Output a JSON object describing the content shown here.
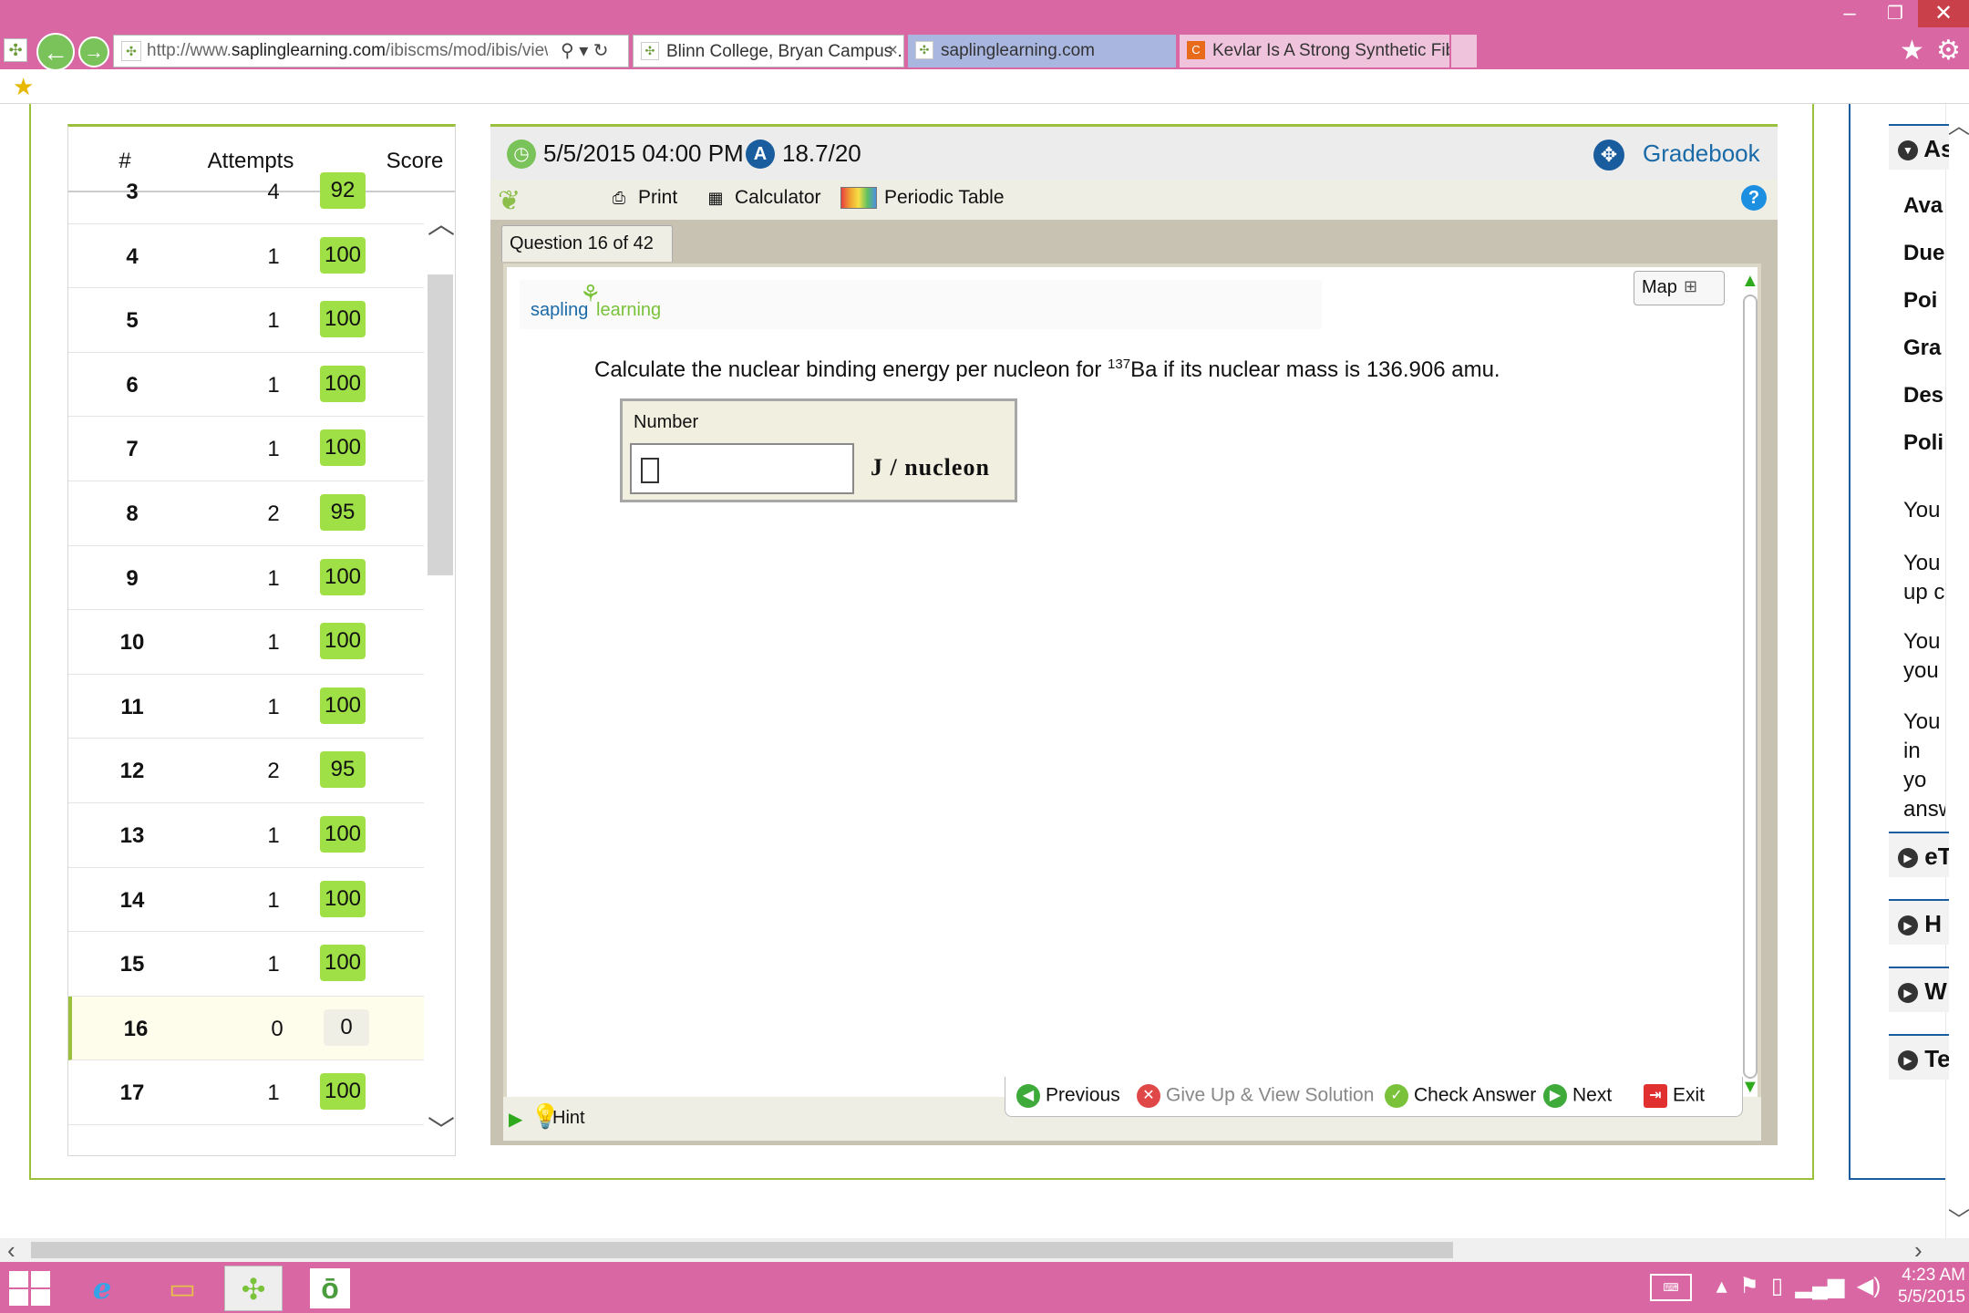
{
  "browser": {
    "window_controls": {
      "minimize": "–",
      "maximize": "❐",
      "close": "✕"
    },
    "back": "←",
    "forward": "→",
    "address_prefix": "http://www.",
    "address_domain": "saplinglearning.com",
    "address_path": "/ibiscms/mod/ibis/view.p",
    "address_tools": "⚲ ▾ ↻",
    "tabs": [
      {
        "label": "Blinn College, Bryan Campus ...",
        "close": "×"
      },
      {
        "label": "saplinglearning.com"
      },
      {
        "label": "Kevlar Is A Strong Synthetic Fib..."
      }
    ],
    "icons": {
      "favorites": "★",
      "tools": "⚙",
      "fav_bar_star": "★"
    }
  },
  "score_table": {
    "headers": {
      "num": "#",
      "attempts": "Attempts",
      "score": "Score"
    },
    "rows": [
      {
        "num": "3",
        "attempts": "4",
        "score": "92"
      },
      {
        "num": "4",
        "attempts": "1",
        "score": "100"
      },
      {
        "num": "5",
        "attempts": "1",
        "score": "100"
      },
      {
        "num": "6",
        "attempts": "1",
        "score": "100"
      },
      {
        "num": "7",
        "attempts": "1",
        "score": "100"
      },
      {
        "num": "8",
        "attempts": "2",
        "score": "95"
      },
      {
        "num": "9",
        "attempts": "1",
        "score": "100"
      },
      {
        "num": "10",
        "attempts": "1",
        "score": "100"
      },
      {
        "num": "11",
        "attempts": "1",
        "score": "100"
      },
      {
        "num": "12",
        "attempts": "2",
        "score": "95"
      },
      {
        "num": "13",
        "attempts": "1",
        "score": "100"
      },
      {
        "num": "14",
        "attempts": "1",
        "score": "100"
      },
      {
        "num": "15",
        "attempts": "1",
        "score": "100"
      },
      {
        "num": "16",
        "attempts": "0",
        "score": "0",
        "current": true
      },
      {
        "num": "17",
        "attempts": "1",
        "score": "100"
      }
    ]
  },
  "question": {
    "due_date": "5/5/2015 04:00 PM",
    "score": "18.7/20",
    "gradebook": "Gradebook",
    "tools": {
      "print": "Print",
      "calculator": "Calculator",
      "periodic_table": "Periodic Table"
    },
    "tab_label": "Question 16 of 42",
    "logo_part1": "sapling",
    "logo_part2": "learning",
    "map_label": "Map",
    "prompt_before": "Calculate the nuclear binding energy per nucleon for ",
    "isotope_mass_number": "137",
    "prompt_after": "Ba if its nuclear mass is 136.906 amu.",
    "answer_label": "Number",
    "answer_value": "",
    "answer_unit": "J / nucleon",
    "hint": "Hint",
    "nav": {
      "previous": "Previous",
      "give_up": "Give Up & View Solution",
      "check": "Check Answer",
      "next": "Next",
      "exit": "Exit"
    }
  },
  "right_sidebar": {
    "section_title": "As",
    "fields": [
      "Ava",
      "Due",
      "Poi",
      "Gra",
      "Des",
      "Poli"
    ],
    "notes": [
      "You",
      "You up c",
      "You you",
      "You in yo answ"
    ],
    "collapsed_sections": [
      "eT",
      "H",
      "W",
      "Te"
    ]
  },
  "taskbar": {
    "time": "4:23 AM",
    "date": "5/5/2015"
  }
}
